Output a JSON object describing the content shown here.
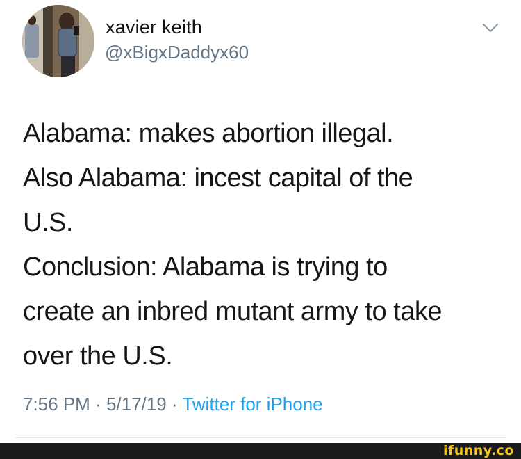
{
  "author": {
    "display_name": "xavier keith",
    "handle": "@xBigxDaddyx60"
  },
  "tweet": {
    "lines": [
      "Alabama: makes abortion illegal.",
      "Also Alabama: incest capital of the",
      "U.S.",
      "Conclusion: Alabama is trying to",
      "create an inbred mutant army to take",
      "over the U.S."
    ],
    "time": "7:56 PM",
    "date": "5/17/19",
    "separator": " · ",
    "source": "Twitter for iPhone"
  },
  "icons": {
    "menu": "chevron-down-icon"
  },
  "watermark": "ifunny.co",
  "colors": {
    "text": "#14171a",
    "secondary": "#657786",
    "link": "#1da1f2",
    "watermark": "#f5c518",
    "footer": "#181a1b"
  }
}
